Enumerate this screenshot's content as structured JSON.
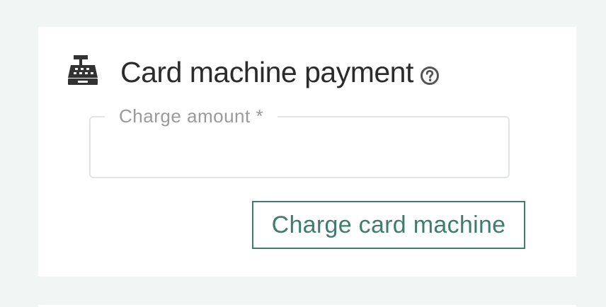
{
  "panel": {
    "icon": "cash-register-icon",
    "title": "Card machine payment",
    "help_icon": "help-circle-icon"
  },
  "form": {
    "charge_amount": {
      "label": "Charge amount *",
      "value": ""
    }
  },
  "actions": {
    "charge_label": "Charge card machine"
  },
  "colors": {
    "page_background": "#f1f6f5",
    "card_background": "#ffffff",
    "accent": "#3f7c6e",
    "title_text": "#2b2b2b",
    "label_text": "#9a9a9a",
    "field_border": "#e2e5e5"
  }
}
